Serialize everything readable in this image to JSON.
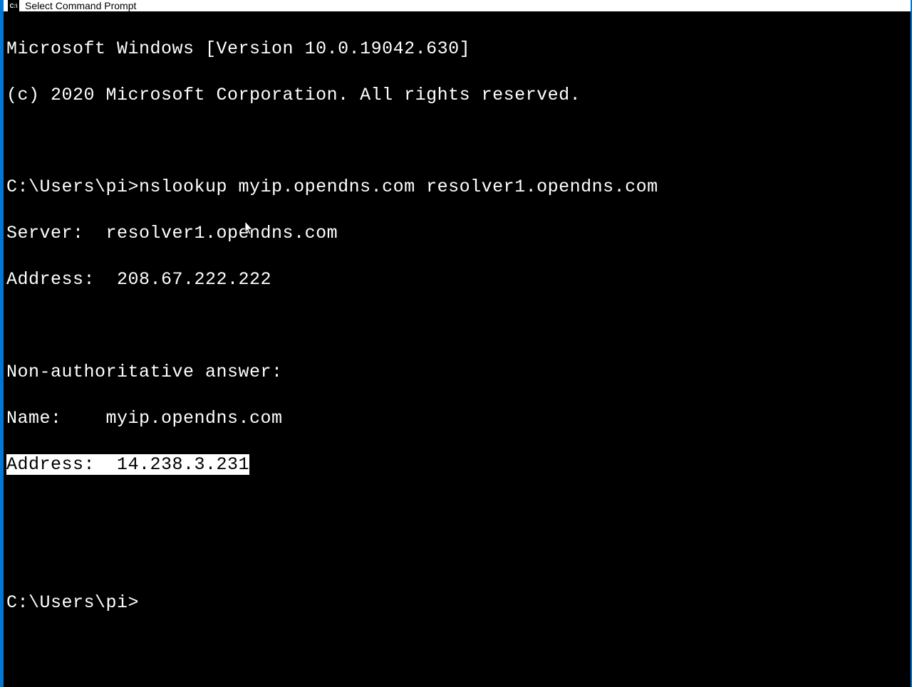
{
  "titlebar": {
    "icon_text": "C:\\",
    "title": "Select Command Prompt"
  },
  "terminal": {
    "banner1": "Microsoft Windows [Version 10.0.19042.630]",
    "banner2": "(c) 2020 Microsoft Corporation. All rights reserved.",
    "blank1": "",
    "prompt1": "C:\\Users\\pi>nslookup myip.opendns.com resolver1.opendns.com",
    "server_line": "Server:  resolver1.opendns.com",
    "server_addr": "Address:  208.67.222.222",
    "blank2": "",
    "nonauth": "Non-authoritative answer:",
    "name_line": "Name:    myip.opendns.com",
    "addr_selected": "Address:  14.238.3.231",
    "blank3": "",
    "blank4": "",
    "prompt2": "C:\\Users\\pi>"
  }
}
